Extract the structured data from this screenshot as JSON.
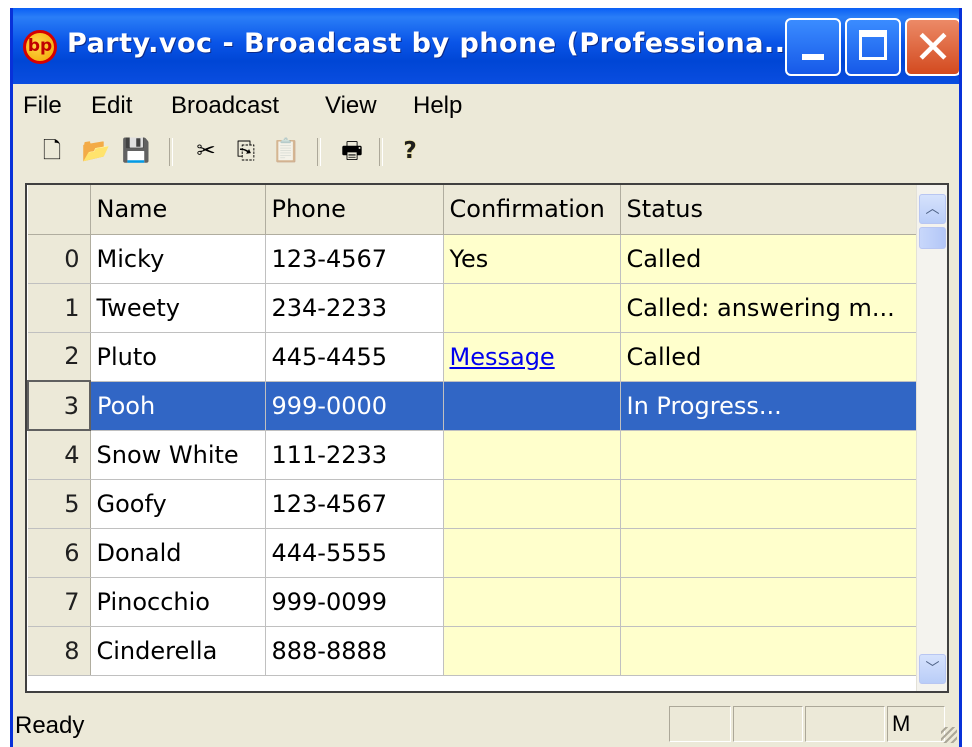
{
  "window": {
    "title": "Party.voc - Broadcast by phone (Professiona...",
    "app_icon_text": "bp",
    "close_glyph": "✕"
  },
  "menu": [
    "File",
    "Edit",
    "Broadcast",
    "View",
    "Help"
  ],
  "toolbar": {
    "icons": [
      "new-document-icon",
      "open-folder-icon",
      "save-icon",
      "cut-icon",
      "copy-icon",
      "paste-icon",
      "print-icon",
      "help-icon"
    ],
    "glyphs": {
      "new": "🗋",
      "open": "📂",
      "save": "💾",
      "cut": "✂",
      "copy": "⎘",
      "paste": "📋",
      "print": "🖶",
      "help": "?"
    }
  },
  "grid": {
    "columns": [
      "Name",
      "Phone",
      "Confirmation",
      "Status"
    ],
    "rows": [
      {
        "num": "0",
        "name": "Micky",
        "phone": "123-4567",
        "confirmation": "Yes",
        "status": "Called"
      },
      {
        "num": "1",
        "name": "Tweety",
        "phone": "234-2233",
        "confirmation": "",
        "status": "Called: answering m..."
      },
      {
        "num": "2",
        "name": "Pluto",
        "phone": "445-4455",
        "confirmation": "Message",
        "status": "Called"
      },
      {
        "num": "3",
        "name": "Pooh",
        "phone": "999-0000",
        "confirmation": "",
        "status": "In Progress..."
      },
      {
        "num": "4",
        "name": "Snow White",
        "phone": "111-2233",
        "confirmation": "",
        "status": ""
      },
      {
        "num": "5",
        "name": "Goofy",
        "phone": "123-4567",
        "confirmation": "",
        "status": ""
      },
      {
        "num": "6",
        "name": "Donald",
        "phone": "444-5555",
        "confirmation": "",
        "status": ""
      },
      {
        "num": "7",
        "name": "Pinocchio",
        "phone": "999-0099",
        "confirmation": "",
        "status": ""
      },
      {
        "num": "8",
        "name": "Cinderella",
        "phone": "888-8888",
        "confirmation": "",
        "status": ""
      }
    ],
    "selected_row": "3",
    "scroll_glyphs": {
      "up": "︿",
      "down": "﹀"
    }
  },
  "statusbar": {
    "text": "Ready",
    "indicator": "M"
  },
  "colors": {
    "titlebar_blue": "#0a55e8",
    "selection": "#3166c5",
    "editable_cell": "#ffffcc",
    "chrome": "#ece9d8",
    "link": "#0000ee"
  }
}
